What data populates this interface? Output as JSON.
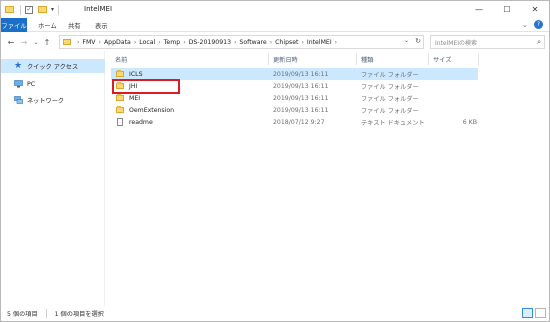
{
  "window": {
    "title": "IntelMEI",
    "controls": {
      "minimize": "—",
      "maximize": "☐",
      "close": "✕"
    }
  },
  "ribbon": {
    "tabs": [
      "ファイル",
      "ホーム",
      "共有",
      "表示"
    ],
    "expand_icon": "⌄",
    "help_icon": "?"
  },
  "nav": {
    "back": "←",
    "forward": "→",
    "recent": "⌄",
    "up": "↑",
    "breadcrumbs": [
      "FMV",
      "AppData",
      "Local",
      "Temp",
      "DS-20190913",
      "Software",
      "Chipset",
      "IntelMEI"
    ],
    "search_placeholder": "IntelMEIの検索"
  },
  "sidebar": {
    "items": [
      {
        "label": "クイック アクセス",
        "icon": "star-icon",
        "selected": true
      },
      {
        "label": "PC",
        "icon": "pc-icon",
        "selected": false
      },
      {
        "label": "ネットワーク",
        "icon": "network-icon",
        "selected": false
      }
    ]
  },
  "columns": {
    "name": "名前",
    "modified": "更新日時",
    "type": "種類",
    "size": "サイズ"
  },
  "files": [
    {
      "name": "ICLS",
      "modified": "2019/09/13 16:11",
      "type": "ファイル フォルダー",
      "size": "",
      "kind": "folder",
      "selected": true
    },
    {
      "name": "JHI",
      "modified": "2019/09/13 16:11",
      "type": "ファイル フォルダー",
      "size": "",
      "kind": "folder",
      "selected": false
    },
    {
      "name": "MEI",
      "modified": "2019/09/13 16:11",
      "type": "ファイル フォルダー",
      "size": "",
      "kind": "folder",
      "selected": false
    },
    {
      "name": "OemExtension",
      "modified": "2019/09/13 16:11",
      "type": "ファイル フォルダー",
      "size": "",
      "kind": "folder",
      "selected": false
    },
    {
      "name": "readme",
      "modified": "2018/07/12 9:27",
      "type": "テキスト ドキュメント",
      "size": "6 KB",
      "kind": "text",
      "selected": false
    }
  ],
  "status": {
    "count": "5 個の項目",
    "selection": "1 個の項目を選択"
  },
  "colors": {
    "accent": "#1a6fc8",
    "selection": "#cce8ff",
    "highlight": "#d81d24"
  }
}
